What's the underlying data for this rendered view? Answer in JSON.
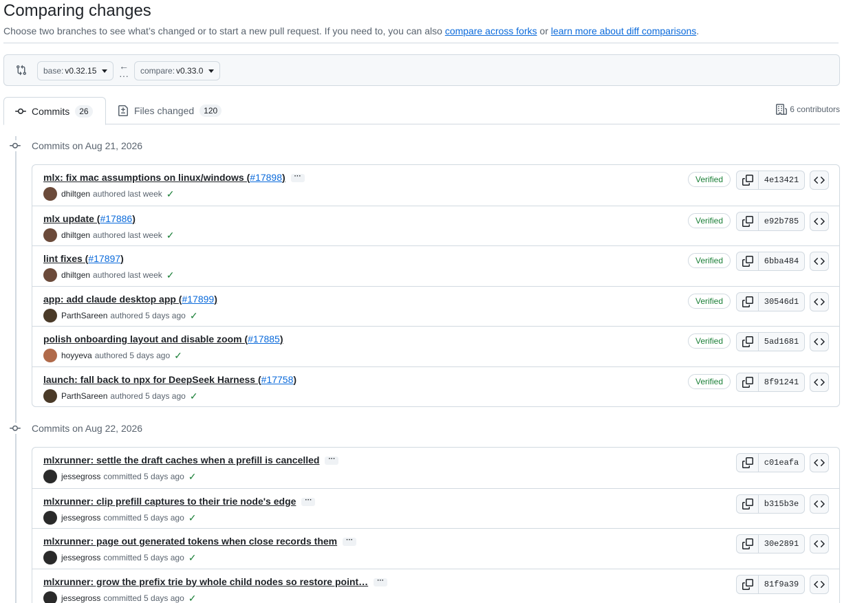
{
  "header": {
    "title": "Comparing changes",
    "description_prefix": "Choose two branches to see what’s changed or to start a new pull request. If you need to, you can also ",
    "link_forks": "compare across forks",
    "description_or": " or ",
    "link_learn": "learn more about diff comparisons",
    "description_suffix": "."
  },
  "range": {
    "base_prefix": "base: ",
    "base_value": "v0.32.15",
    "compare_prefix": "compare: ",
    "compare_value": "v0.33.0"
  },
  "tabs": [
    {
      "label": "Commits",
      "count": "26",
      "active": true
    },
    {
      "label": "Files changed",
      "count": "120",
      "active": false
    }
  ],
  "contributors": "6 contributors",
  "groups": [
    {
      "date_label": "Commits on Aug 21, 2026",
      "commits": [
        {
          "title": "mlx: fix mac assumptions on linux/windows (",
          "pr": "#17898",
          "close": ")",
          "ellipsis": true,
          "author": "dhiltgen",
          "action": "authored last week",
          "verified": "Verified",
          "sha": "4e13421",
          "avatar_color": "#6b4a3a"
        },
        {
          "title": "mlx update (",
          "pr": "#17886",
          "close": ")",
          "ellipsis": false,
          "author": "dhiltgen",
          "action": "authored last week",
          "verified": "Verified",
          "sha": "e92b785",
          "avatar_color": "#6b4a3a"
        },
        {
          "title": "lint fixes (",
          "pr": "#17897",
          "close": ")",
          "ellipsis": false,
          "author": "dhiltgen",
          "action": "authored last week",
          "verified": "Verified",
          "sha": "6bba484",
          "avatar_color": "#6b4a3a"
        },
        {
          "title": "app: add claude desktop app (",
          "pr": "#17899",
          "close": ")",
          "ellipsis": false,
          "author": "ParthSareen",
          "action": "authored 5 days ago",
          "verified": "Verified",
          "sha": "30546d1",
          "avatar_color": "#4a3a28"
        },
        {
          "title": "polish onboarding layout and disable zoom (",
          "pr": "#17885",
          "close": ")",
          "ellipsis": false,
          "author": "hoyyeva",
          "action": "authored 5 days ago",
          "verified": "Verified",
          "sha": "5ad1681",
          "avatar_color": "#b06a4a"
        },
        {
          "title": "launch: fall back to npx for DeepSeek Harness (",
          "pr": "#17758",
          "close": ")",
          "ellipsis": false,
          "author": "ParthSareen",
          "action": "authored 5 days ago",
          "verified": "Verified",
          "sha": "8f91241",
          "avatar_color": "#4a3a28"
        }
      ]
    },
    {
      "date_label": "Commits on Aug 22, 2026",
      "commits": [
        {
          "title": "mlxrunner: settle the draft caches when a prefill is cancelled",
          "pr": "",
          "close": "",
          "ellipsis": true,
          "author": "jessegross",
          "action": "committed 5 days ago",
          "verified": "",
          "sha": "c01eafa",
          "avatar_color": "#2a2a2a"
        },
        {
          "title": "mlxrunner: clip prefill captures to their trie node's edge",
          "pr": "",
          "close": "",
          "ellipsis": true,
          "author": "jessegross",
          "action": "committed 5 days ago",
          "verified": "",
          "sha": "b315b3e",
          "avatar_color": "#2a2a2a"
        },
        {
          "title": "mlxrunner: page out generated tokens when close records them",
          "pr": "",
          "close": "",
          "ellipsis": true,
          "author": "jessegross",
          "action": "committed 5 days ago",
          "verified": "",
          "sha": "30e2891",
          "avatar_color": "#2a2a2a"
        },
        {
          "title": "mlxrunner: grow the prefix trie by whole child nodes so restore point…",
          "pr": "",
          "close": "",
          "ellipsis": true,
          "author": "jessegross",
          "action": "committed 5 days ago",
          "verified": "",
          "sha": "81f9a39",
          "avatar_color": "#2a2a2a"
        }
      ]
    }
  ]
}
